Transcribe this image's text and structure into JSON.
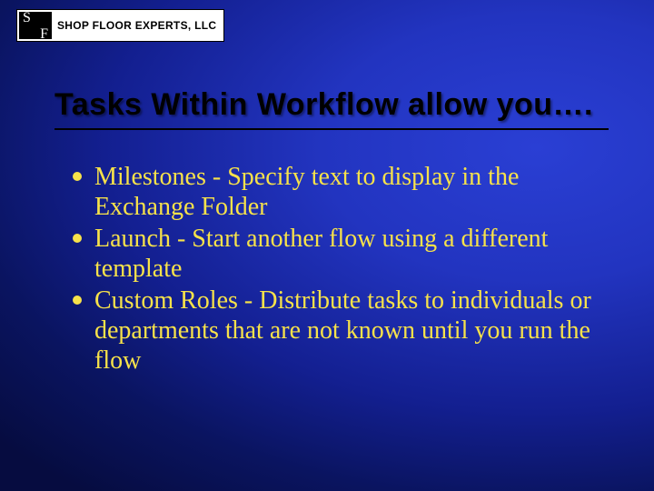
{
  "logo": {
    "initials_s": "S",
    "initials_f": "F",
    "company": "SHOP FLOOR EXPERTS, LLC"
  },
  "title": "Tasks Within Workflow allow you….",
  "bullets": [
    "Milestones - Specify text to display in the Exchange Folder",
    "Launch - Start another flow using a different template",
    "Custom Roles - Distribute tasks to individuals or departments that are not known until you run the flow"
  ]
}
